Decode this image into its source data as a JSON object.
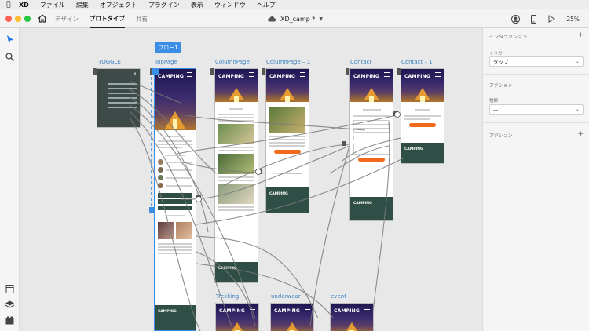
{
  "menubar": {
    "app": "XD",
    "items": [
      "ファイル",
      "編集",
      "オブジェクト",
      "プラグイン",
      "表示",
      "ウィンドウ",
      "ヘルプ"
    ]
  },
  "titlebar": {
    "tabs": [
      {
        "label": "デザイン",
        "active": false
      },
      {
        "label": "プロトタイプ",
        "active": true
      },
      {
        "label": "共有",
        "active": false
      }
    ],
    "document_title": "XD_camp *",
    "zoom": "25%"
  },
  "canvas": {
    "flow_tag": "フロー1",
    "artboards": [
      {
        "id": "toggle",
        "label": "TOGGLE"
      },
      {
        "id": "toppage",
        "label": "TopPage"
      },
      {
        "id": "columnpage",
        "label": "ColumnPage"
      },
      {
        "id": "columnpage1",
        "label": "ColumnPage – 1"
      },
      {
        "id": "contact",
        "label": "Contact"
      },
      {
        "id": "contact1",
        "label": "Contact – 1"
      },
      {
        "id": "trekking",
        "label": "Trekking"
      },
      {
        "id": "underwear",
        "label": "underwear"
      },
      {
        "id": "event",
        "label": "event"
      }
    ],
    "brand_text": "CAMPING"
  },
  "right_panel": {
    "interaction_heading": "インタラクション",
    "trigger_label": "トリガー",
    "trigger_value": "タップ",
    "action_heading": "アクション",
    "type_label": "種類",
    "type_value": "—",
    "action_heading2": "アクション"
  },
  "colors": {
    "accent": "#3a8ee6",
    "wire": "#7a7a7a",
    "footer_green": "#2f4f46",
    "cta_orange": "#ef6a1b"
  }
}
